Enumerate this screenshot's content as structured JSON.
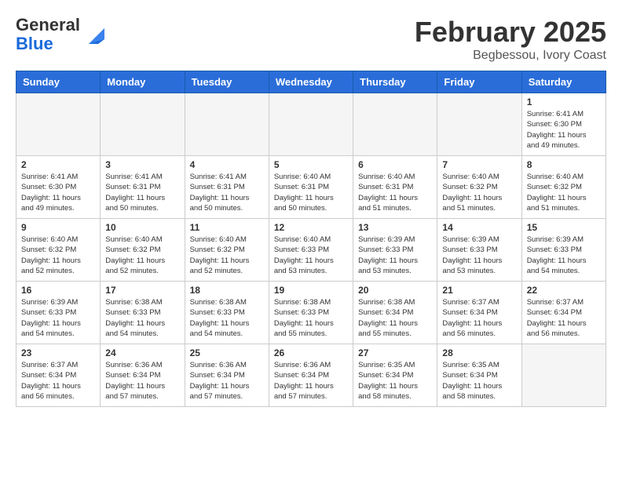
{
  "header": {
    "logo_general": "General",
    "logo_blue": "Blue",
    "month_title": "February 2025",
    "location": "Begbessou, Ivory Coast"
  },
  "calendar": {
    "days_of_week": [
      "Sunday",
      "Monday",
      "Tuesday",
      "Wednesday",
      "Thursday",
      "Friday",
      "Saturday"
    ],
    "weeks": [
      [
        {
          "day": "",
          "info": ""
        },
        {
          "day": "",
          "info": ""
        },
        {
          "day": "",
          "info": ""
        },
        {
          "day": "",
          "info": ""
        },
        {
          "day": "",
          "info": ""
        },
        {
          "day": "",
          "info": ""
        },
        {
          "day": "1",
          "info": "Sunrise: 6:41 AM\nSunset: 6:30 PM\nDaylight: 11 hours and 49 minutes."
        }
      ],
      [
        {
          "day": "2",
          "info": "Sunrise: 6:41 AM\nSunset: 6:30 PM\nDaylight: 11 hours and 49 minutes."
        },
        {
          "day": "3",
          "info": "Sunrise: 6:41 AM\nSunset: 6:31 PM\nDaylight: 11 hours and 50 minutes."
        },
        {
          "day": "4",
          "info": "Sunrise: 6:41 AM\nSunset: 6:31 PM\nDaylight: 11 hours and 50 minutes."
        },
        {
          "day": "5",
          "info": "Sunrise: 6:40 AM\nSunset: 6:31 PM\nDaylight: 11 hours and 50 minutes."
        },
        {
          "day": "6",
          "info": "Sunrise: 6:40 AM\nSunset: 6:31 PM\nDaylight: 11 hours and 51 minutes."
        },
        {
          "day": "7",
          "info": "Sunrise: 6:40 AM\nSunset: 6:32 PM\nDaylight: 11 hours and 51 minutes."
        },
        {
          "day": "8",
          "info": "Sunrise: 6:40 AM\nSunset: 6:32 PM\nDaylight: 11 hours and 51 minutes."
        }
      ],
      [
        {
          "day": "9",
          "info": "Sunrise: 6:40 AM\nSunset: 6:32 PM\nDaylight: 11 hours and 52 minutes."
        },
        {
          "day": "10",
          "info": "Sunrise: 6:40 AM\nSunset: 6:32 PM\nDaylight: 11 hours and 52 minutes."
        },
        {
          "day": "11",
          "info": "Sunrise: 6:40 AM\nSunset: 6:32 PM\nDaylight: 11 hours and 52 minutes."
        },
        {
          "day": "12",
          "info": "Sunrise: 6:40 AM\nSunset: 6:33 PM\nDaylight: 11 hours and 53 minutes."
        },
        {
          "day": "13",
          "info": "Sunrise: 6:39 AM\nSunset: 6:33 PM\nDaylight: 11 hours and 53 minutes."
        },
        {
          "day": "14",
          "info": "Sunrise: 6:39 AM\nSunset: 6:33 PM\nDaylight: 11 hours and 53 minutes."
        },
        {
          "day": "15",
          "info": "Sunrise: 6:39 AM\nSunset: 6:33 PM\nDaylight: 11 hours and 54 minutes."
        }
      ],
      [
        {
          "day": "16",
          "info": "Sunrise: 6:39 AM\nSunset: 6:33 PM\nDaylight: 11 hours and 54 minutes."
        },
        {
          "day": "17",
          "info": "Sunrise: 6:38 AM\nSunset: 6:33 PM\nDaylight: 11 hours and 54 minutes."
        },
        {
          "day": "18",
          "info": "Sunrise: 6:38 AM\nSunset: 6:33 PM\nDaylight: 11 hours and 54 minutes."
        },
        {
          "day": "19",
          "info": "Sunrise: 6:38 AM\nSunset: 6:33 PM\nDaylight: 11 hours and 55 minutes."
        },
        {
          "day": "20",
          "info": "Sunrise: 6:38 AM\nSunset: 6:34 PM\nDaylight: 11 hours and 55 minutes."
        },
        {
          "day": "21",
          "info": "Sunrise: 6:37 AM\nSunset: 6:34 PM\nDaylight: 11 hours and 56 minutes."
        },
        {
          "day": "22",
          "info": "Sunrise: 6:37 AM\nSunset: 6:34 PM\nDaylight: 11 hours and 56 minutes."
        }
      ],
      [
        {
          "day": "23",
          "info": "Sunrise: 6:37 AM\nSunset: 6:34 PM\nDaylight: 11 hours and 56 minutes."
        },
        {
          "day": "24",
          "info": "Sunrise: 6:36 AM\nSunset: 6:34 PM\nDaylight: 11 hours and 57 minutes."
        },
        {
          "day": "25",
          "info": "Sunrise: 6:36 AM\nSunset: 6:34 PM\nDaylight: 11 hours and 57 minutes."
        },
        {
          "day": "26",
          "info": "Sunrise: 6:36 AM\nSunset: 6:34 PM\nDaylight: 11 hours and 57 minutes."
        },
        {
          "day": "27",
          "info": "Sunrise: 6:35 AM\nSunset: 6:34 PM\nDaylight: 11 hours and 58 minutes."
        },
        {
          "day": "28",
          "info": "Sunrise: 6:35 AM\nSunset: 6:34 PM\nDaylight: 11 hours and 58 minutes."
        },
        {
          "day": "",
          "info": ""
        }
      ]
    ]
  }
}
